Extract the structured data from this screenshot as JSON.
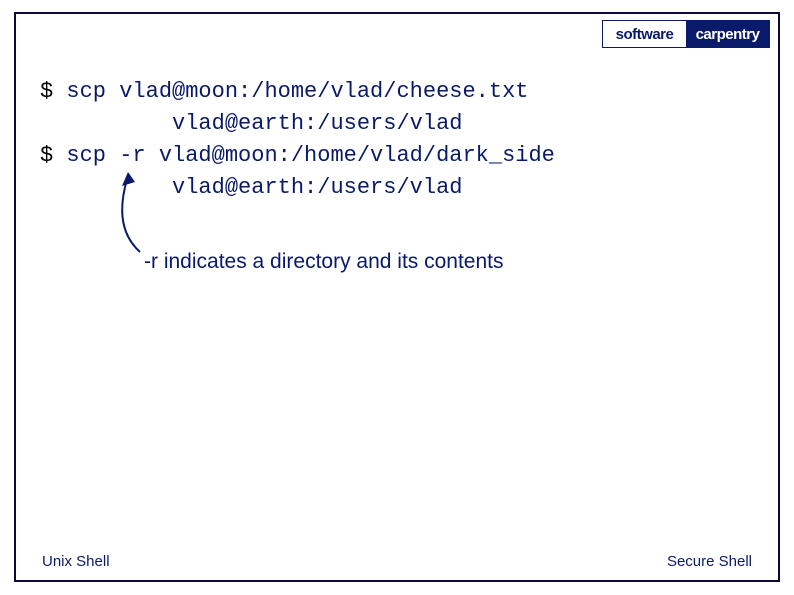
{
  "logo": {
    "left": "software",
    "right": "carpentry"
  },
  "commands": {
    "line1_prompt": "$",
    "line1_cmd": " scp vlad@moon:/home/vlad/cheese.txt",
    "line2_cmd": "          vlad@earth:/users/vlad",
    "line3_prompt": "$",
    "line3_cmd": " scp -r vlad@moon:/home/vlad/dark_side",
    "line4_cmd": "          vlad@earth:/users/vlad"
  },
  "annotation": "-r indicates a directory and its contents",
  "footer": {
    "left": "Unix Shell",
    "right": "Secure Shell"
  }
}
